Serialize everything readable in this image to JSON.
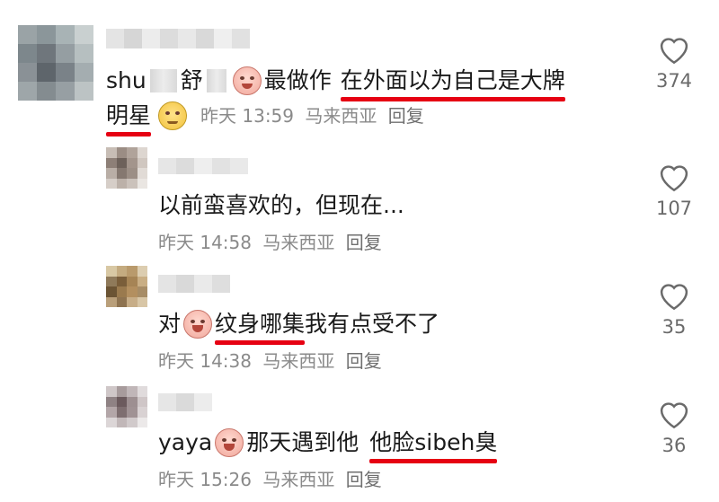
{
  "colors": {
    "underline": "#e60012",
    "meta": "#8a8a8a",
    "text": "#1a1a1a"
  },
  "comments": [
    {
      "name_prefix": "shu",
      "name_mid": "舒",
      "text_before": "最做作",
      "highlight_1": "在外面以为自己是大牌",
      "highlight_2": "明星",
      "time": "昨天 13:59",
      "location": "马来西亚",
      "reply_label": "回复",
      "likes": "374",
      "icons": [
        "laugh-cry-emoji-icon",
        "smirk-emoji-icon",
        "heart-outline-icon"
      ]
    },
    {
      "text": "以前蛮喜欢的，但现在...",
      "time": "昨天 14:58",
      "location": "马来西亚",
      "reply_label": "回复",
      "likes": "107",
      "icons": [
        "heart-outline-icon"
      ]
    },
    {
      "text_before": "对",
      "highlight": "纹身哪集",
      "text_after": "我有点受不了",
      "time": "昨天 14:38",
      "location": "马来西亚",
      "reply_label": "回复",
      "likes": "35",
      "icons": [
        "crying-emoji-icon",
        "heart-outline-icon"
      ]
    },
    {
      "text_before": "yaya",
      "text_mid": "那天遇到他",
      "highlight": "他脸sibeh臭",
      "time": "昨天 15:26",
      "location": "马来西亚",
      "reply_label": "回复",
      "likes": "36",
      "icons": [
        "crying-emoji-icon",
        "heart-outline-icon"
      ]
    }
  ]
}
